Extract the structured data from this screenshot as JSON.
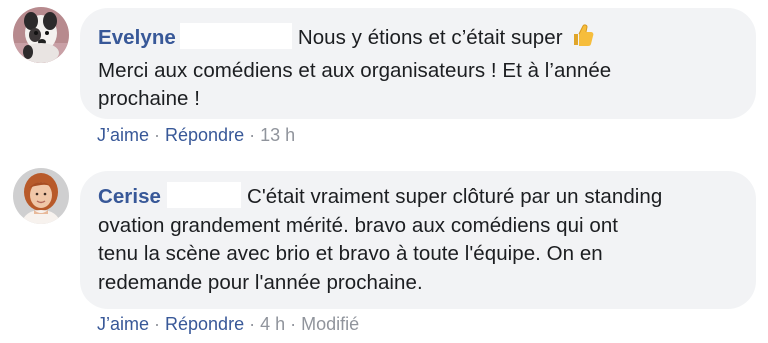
{
  "comments": [
    {
      "author": "Evelyne",
      "text_line1": "Nous y étions et c’était super",
      "text_rest_1": "Merci aux comédiens et aux organisateurs ! Et à l’année",
      "text_rest_2": "prochaine !",
      "reaction_emoji": "thumbs-up",
      "actions": {
        "like": "J’aime",
        "reply": "Répondre",
        "time": "13 h"
      }
    },
    {
      "author": "Cerise",
      "text_line1": "C'était vraiment super clôturé par un standing",
      "text_rest_1": "ovation grandement mérité. bravo aux comédiens qui ont",
      "text_rest_2": "tenu la scène avec brio et bravo à toute l'équipe. On en",
      "text_rest_3": "redemande pour l'année prochaine.",
      "actions": {
        "like": "J’aime",
        "reply": "Répondre",
        "time": "4 h",
        "edited": "Modifié"
      }
    }
  ],
  "colors": {
    "link": "#385898",
    "bubble_bg": "#f2f3f5",
    "meta_gray": "#90949c",
    "text": "#1c1e21"
  }
}
